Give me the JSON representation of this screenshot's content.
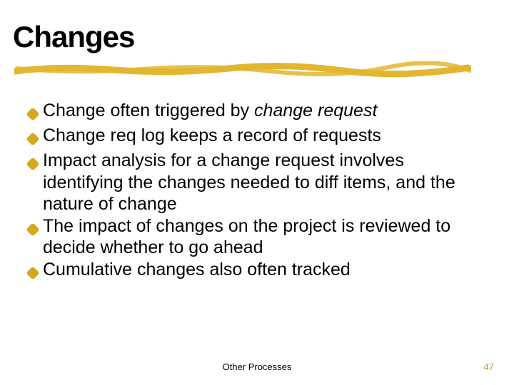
{
  "title": "Changes",
  "bullets": [
    {
      "pre": "Change often triggered by ",
      "em": "change request",
      "post": ""
    },
    {
      "pre": "Change req log keeps a record of requests",
      "em": "",
      "post": ""
    },
    {
      "pre": "Impact analysis for a change request involves identifying the changes needed to diff items, and the nature of change",
      "em": "",
      "post": ""
    },
    {
      "pre": "The impact of changes on the project is reviewed to decide whether to go ahead",
      "em": "",
      "post": ""
    },
    {
      "pre": "Cumulative changes also often tracked",
      "em": "",
      "post": ""
    }
  ],
  "footer": {
    "center": "Other Processes",
    "page": "47"
  },
  "colors": {
    "accent": "#e3b62f",
    "bullet": "#d6a81e"
  }
}
